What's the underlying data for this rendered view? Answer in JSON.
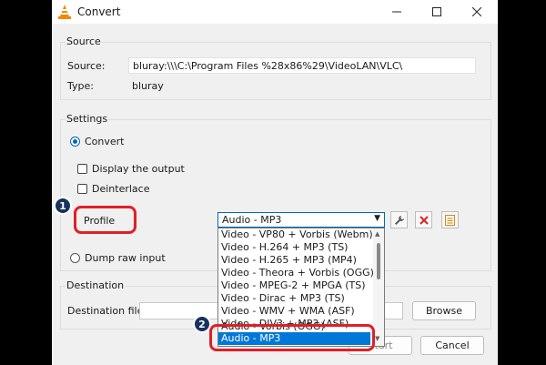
{
  "window": {
    "title": "Convert",
    "icons": {
      "app": "vlc-cone-icon",
      "minimize": "minimize-icon",
      "maximize": "maximize-icon",
      "close": "close-icon"
    }
  },
  "source": {
    "group_title": "Source",
    "source_label": "Source:",
    "source_value": "bluray:\\\\\\C:\\Program Files %28x86%29\\VideoLAN\\VLC\\",
    "type_label": "Type:",
    "type_value": "bluray"
  },
  "settings": {
    "group_title": "Settings",
    "convert_label": "Convert",
    "display_output_label": "Display the output",
    "deinterlace_label": "Deinterlace",
    "profile_label": "Profile",
    "profile_selected": "Audio - MP3",
    "dump_raw_label": "Dump raw input",
    "profile_options": [
      "Video - VP80 + Vorbis (Webm)",
      "Video - H.264 + MP3 (TS)",
      "Video - H.265 + MP3 (MP4)",
      "Video - Theora + Vorbis (OGG)",
      "Video - MPEG-2 + MPGA (TS)",
      "Video - Dirac + MP3 (TS)",
      "Video - WMV + WMA (ASF)",
      "Video - DIV3 + MP3 (ASF)",
      "Audio - Vorbis (OGG)",
      "Audio - MP3"
    ],
    "tool_icons": [
      "wrench-icon",
      "delete-icon",
      "new-profile-icon"
    ]
  },
  "destination": {
    "group_title": "Destination",
    "file_label": "Destination file:",
    "file_value": "",
    "browse_label": "Browse"
  },
  "footer": {
    "start_label": "Start",
    "cancel_label": "Cancel"
  },
  "annotations": {
    "step1": "1",
    "step2": "2",
    "highlight_color": "#e01f26",
    "badge_color": "#17335e"
  },
  "colors": {
    "accent": "#0067c0",
    "selection": "#0078d7"
  }
}
